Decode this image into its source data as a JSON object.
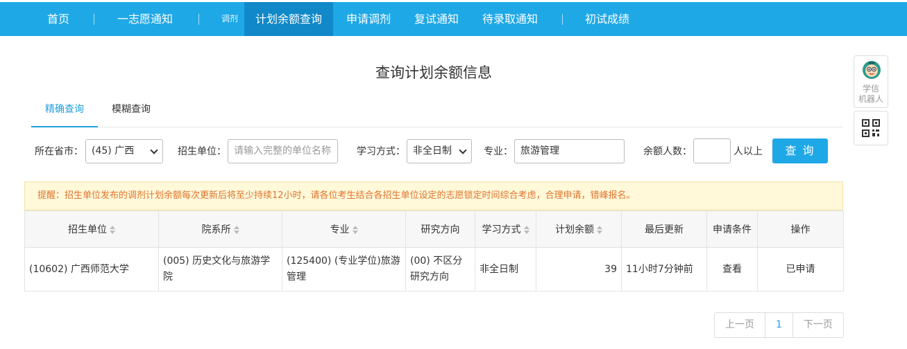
{
  "nav": {
    "items": [
      {
        "label": "首页"
      },
      {
        "label": "一志愿通知"
      },
      {
        "label": "计划余额查询"
      },
      {
        "label": "申请调剂"
      },
      {
        "label": "复试通知"
      },
      {
        "label": "待录取通知"
      },
      {
        "label": "初试成绩"
      }
    ],
    "small_label": "调剂",
    "active_index": 2
  },
  "page_title": "查询计划余额信息",
  "tabs": [
    {
      "label": "精确查询",
      "active": true
    },
    {
      "label": "模糊查询",
      "active": false
    }
  ],
  "filters": {
    "province_label": "所在省市：",
    "province_value": "(45) 广西",
    "unit_label": "招生单位：",
    "unit_placeholder": "请输入完整的单位名称",
    "mode_label": "学习方式：",
    "mode_value": "非全日制",
    "major_label": "专业：",
    "major_value": "旅游管理",
    "quota_label": "余额人数：",
    "quota_value": "",
    "quota_suffix": "人以上",
    "query_button": "查 询"
  },
  "notice": "提醒：招生单位发布的调剂计划余额每次更新后将至少持续12小时，请各位考生结合各招生单位设定的志愿锁定时间综合考虑，合理申请，错峰报名。",
  "table": {
    "headers": [
      "招生单位",
      "院系所",
      "专业",
      "研究方向",
      "学习方式",
      "计划余额",
      "最后更新",
      "申请条件",
      "操作"
    ],
    "rows": [
      {
        "unit": "(10602) 广西师范大学",
        "dept": "(005) 历史文化与旅游学院",
        "major": "(125400) (专业学位)旅游管理",
        "direction": "(00) 不区分研究方向",
        "mode": "非全日制",
        "quota": "39",
        "updated": "11小时7分钟前",
        "condition": "查看",
        "action": "已申请"
      }
    ]
  },
  "pager": {
    "prev": "上一页",
    "current": "1",
    "next": "下一页"
  },
  "widgets": {
    "robot_line1": "学信",
    "robot_line2": "机器人"
  },
  "colors": {
    "nav": "#1fa8e6",
    "nav_active": "#1188c7",
    "accent": "#1fa0dc",
    "notice_text": "#e0742d",
    "notice_bg": "#fff8d9"
  }
}
